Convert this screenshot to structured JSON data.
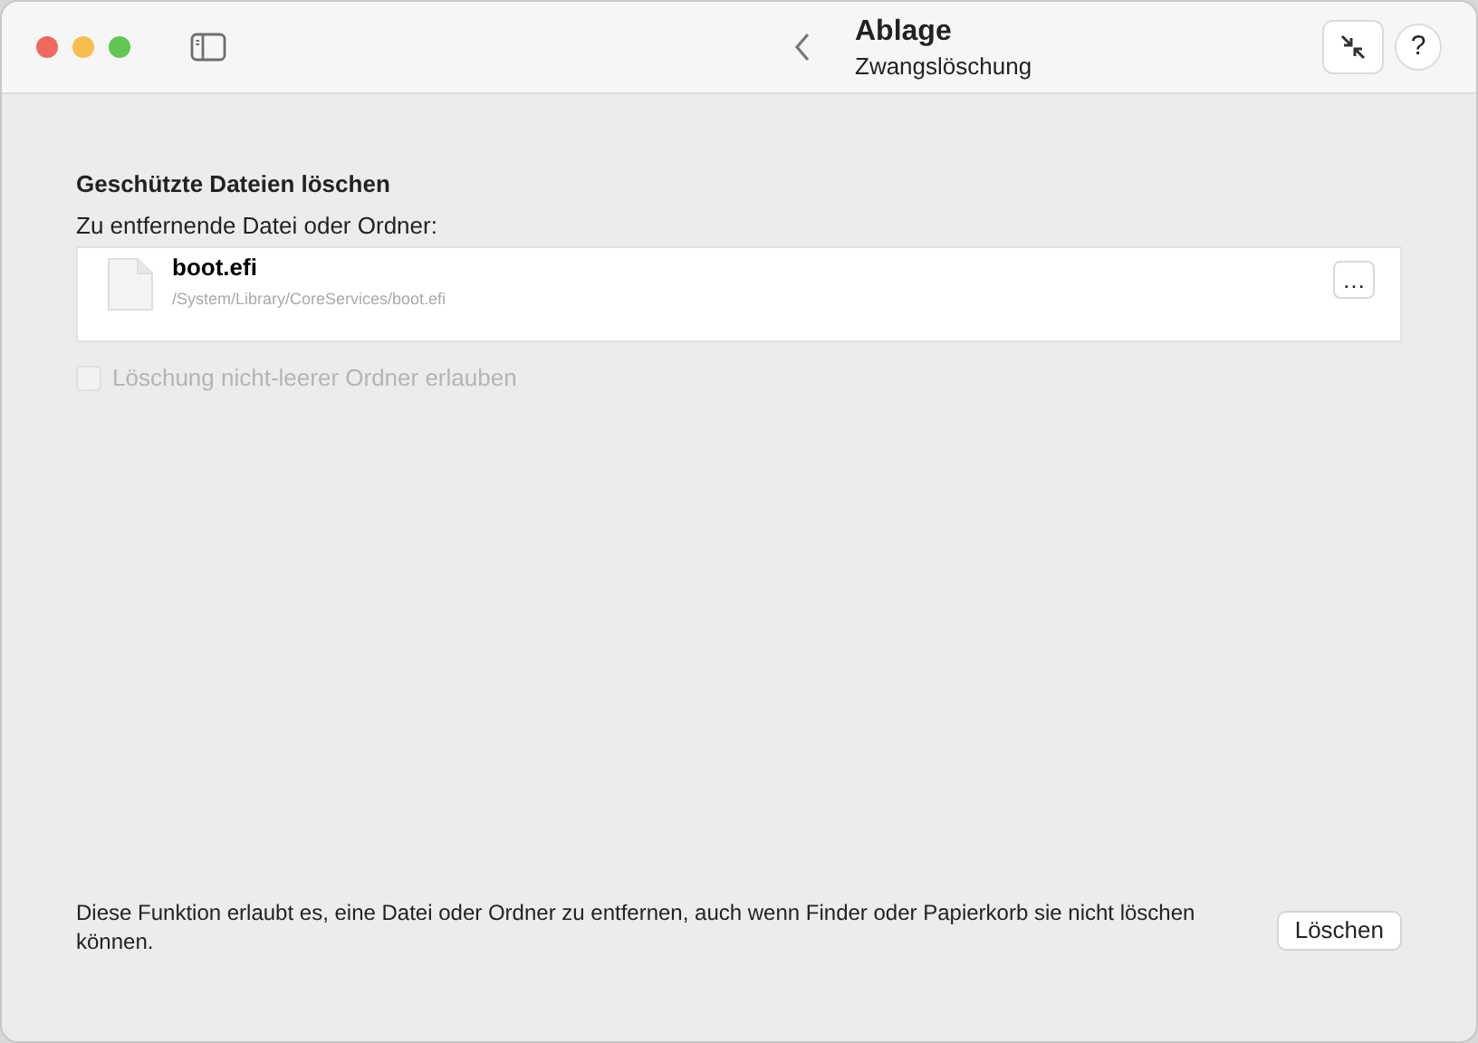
{
  "toolbar": {
    "title": "Ablage",
    "subtitle": "Zwangslöschung",
    "help": "?"
  },
  "section": {
    "heading": "Geschützte Dateien löschen",
    "field_label": "Zu entfernende Datei oder Ordner:"
  },
  "file": {
    "name": "boot.efi",
    "path": "/System/Library/CoreServices/boot.efi",
    "browse": "…"
  },
  "option": {
    "label": "Löschung nicht-leerer Ordner erlauben",
    "checked": false,
    "disabled": true
  },
  "footer": {
    "description": "Diese Funktion erlaubt es, eine Datei oder Ordner zu entfernen, auch wenn Finder oder Papierkorb sie nicht löschen können.",
    "button": "Löschen"
  }
}
